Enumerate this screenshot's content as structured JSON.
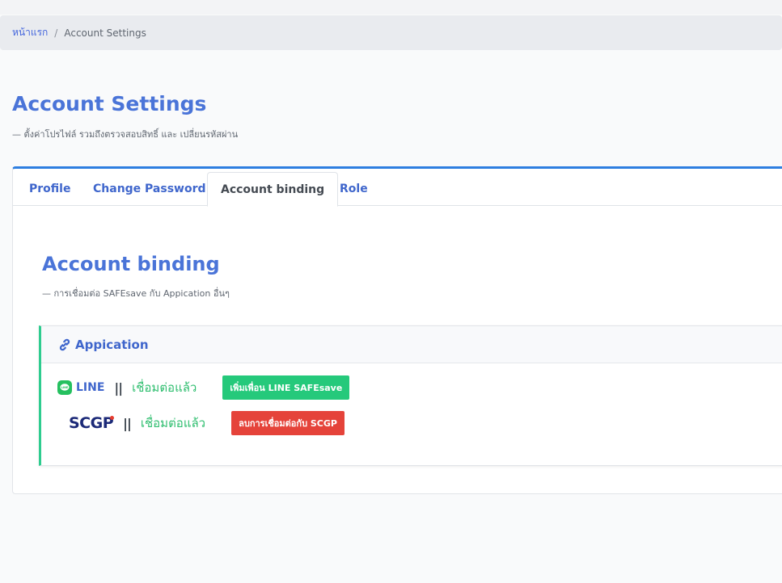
{
  "breadcrumb": {
    "home": "หน้าแรก",
    "separator": "/",
    "current": "Account Settings"
  },
  "page": {
    "title": "Account Settings",
    "subtitle": "— ตั้งค่าโปรไฟล์ รวมถึงตรวจสอบสิทธิ์ และ เปลี่ยนรหัสผ่าน"
  },
  "tabs": [
    {
      "label": "Profile",
      "active": false
    },
    {
      "label": "Change Password",
      "active": false
    },
    {
      "label": "Account binding",
      "active": true
    },
    {
      "label": "Role",
      "active": false
    }
  ],
  "section": {
    "title": "Account binding",
    "subtitle": "— การเชื่อมต่อ SAFEsave กับ Appication อื่นๆ"
  },
  "application": {
    "header": "Appication",
    "icon": "link-icon",
    "line": {
      "icon": "line-logo-icon",
      "label": "LINE",
      "separator": "||",
      "status": "เชื่อมต่อแล้ว",
      "button": "เพิ่มเพื่อน LINE SAFEsave"
    },
    "scgp": {
      "logo": "SCGP",
      "separator": "||",
      "status": "เชื่อมต่อแล้ว",
      "button": "ลบการเชื่อมต่อกับ SCGP"
    }
  },
  "colors": {
    "accent": "#4a74d8",
    "card_top_border": "#2e7ee0",
    "success": "#25c97b",
    "danger": "#e5433a",
    "line_green": "#25c05f"
  }
}
